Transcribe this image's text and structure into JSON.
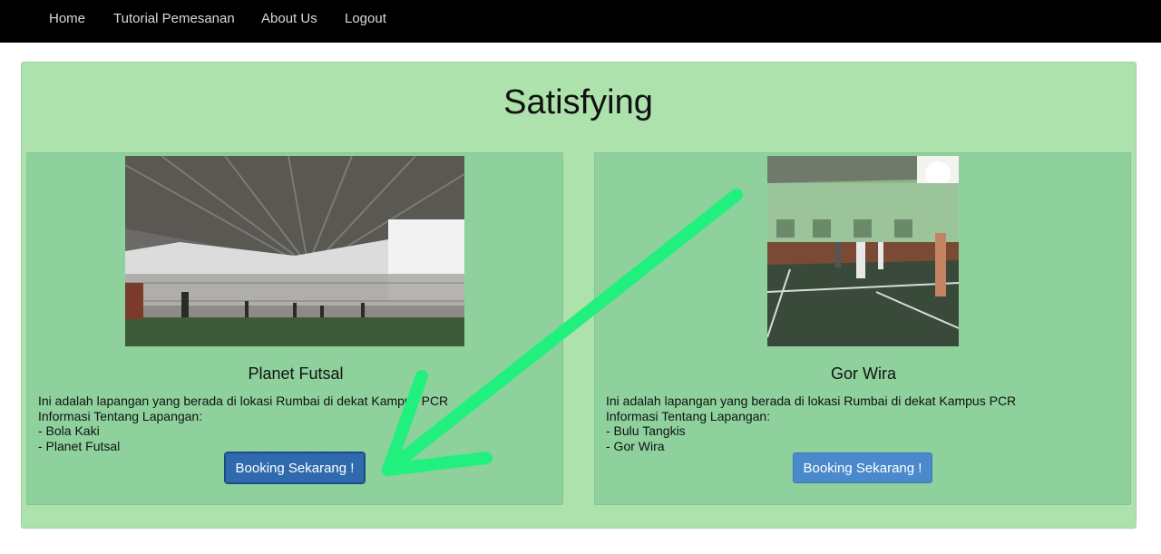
{
  "nav": {
    "items": [
      {
        "label": "Home"
      },
      {
        "label": "Tutorial Pemesanan"
      },
      {
        "label": "About Us"
      },
      {
        "label": "Logout"
      }
    ]
  },
  "main": {
    "title": "Satisfying",
    "cards": [
      {
        "name": "Planet Futsal",
        "description": "Ini adalah lapangan yang berada di lokasi Rumbai di dekat Kampus PCR",
        "info_heading": "Informasi Tentang Lapangan:",
        "info_lines": [
          "- Bola Kaki",
          "- Planet Futsal"
        ],
        "button_label": "Booking Sekarang !"
      },
      {
        "name": "Gor Wira",
        "description": "Ini adalah lapangan yang berada di lokasi Rumbai di dekat Kampus PCR",
        "info_heading": "Informasi Tentang Lapangan:",
        "info_lines": [
          "- Bulu Tangkis",
          "- Gor Wira"
        ],
        "button_label": "Booking Sekarang !"
      }
    ]
  },
  "colors": {
    "navbar": "#000000",
    "panel": "#ade2ad",
    "card": "#8ed19c",
    "button": "#4a89cc",
    "annotation_arrow": "#22f07e"
  }
}
